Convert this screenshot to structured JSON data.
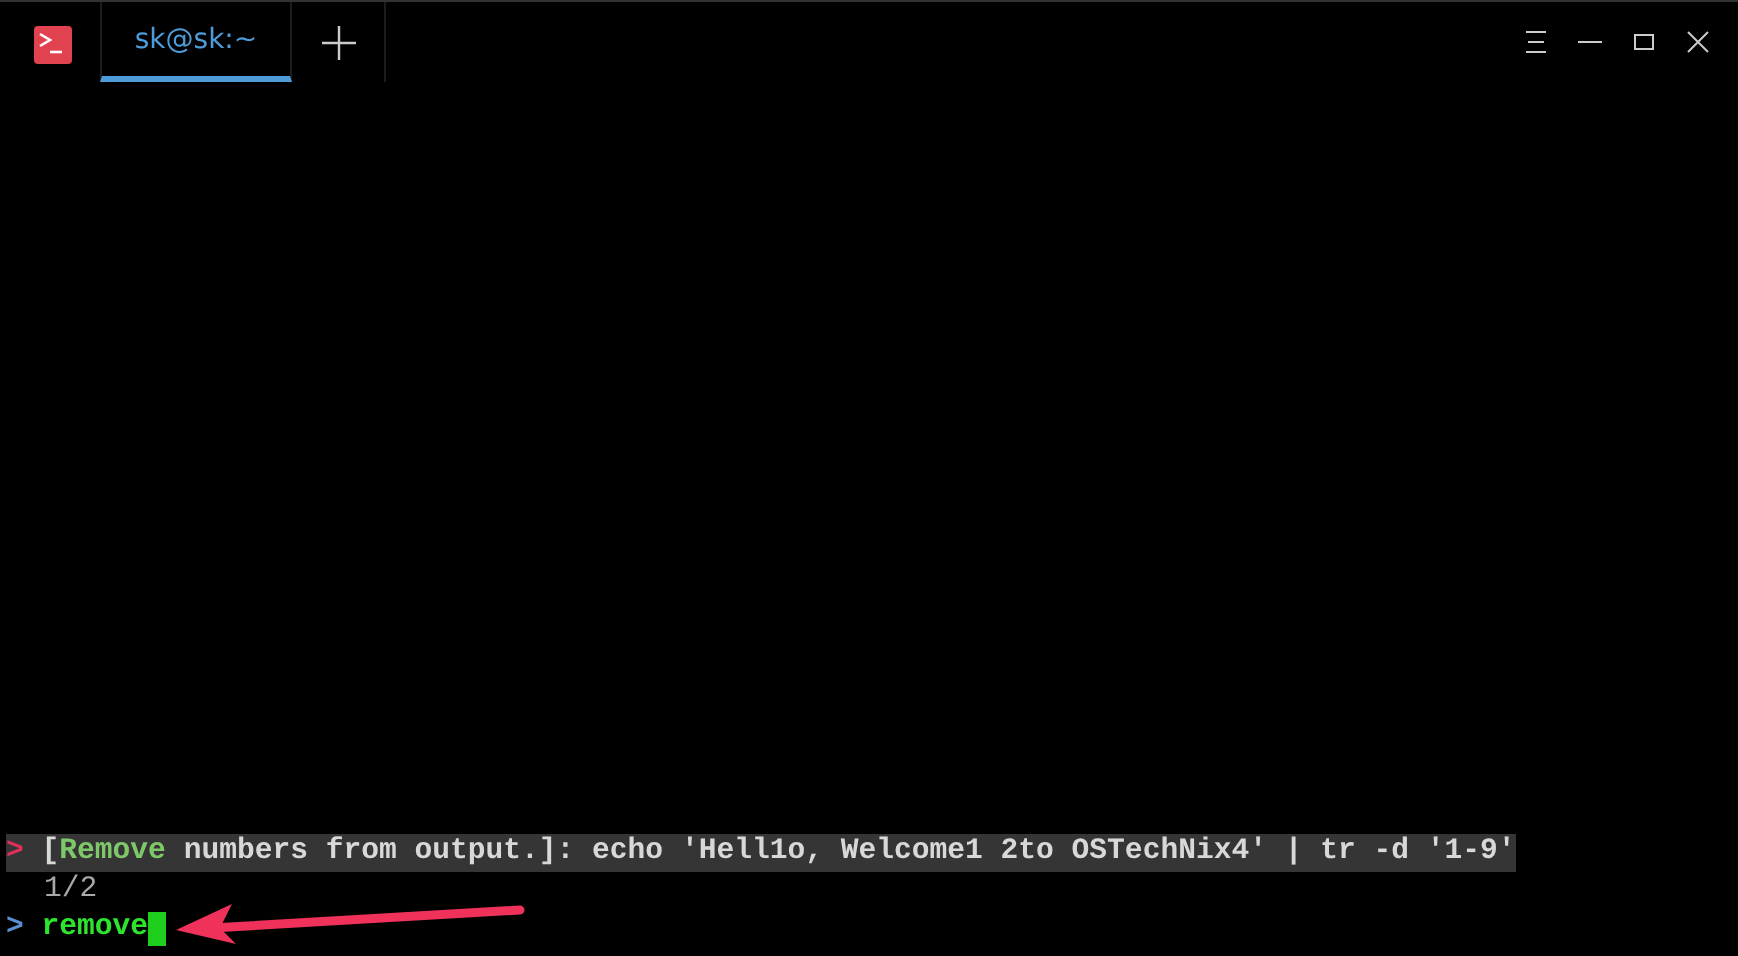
{
  "tabs": [
    {
      "label": "sk@sk:~",
      "selected": true
    }
  ],
  "terminal": {
    "lines": [
      {
        "kind": "candidate",
        "prompt": ">",
        "selected": true,
        "segments": [
          {
            "text": "[",
            "match": false
          },
          {
            "text": "Remove",
            "match": true
          },
          {
            "text": " numbers from output.]: echo 'Hell1o, Welcome1 2to OSTechNix4' | tr -d '1-9'",
            "match": false
          }
        ]
      },
      {
        "kind": "counter",
        "text": "1/2"
      },
      {
        "kind": "input",
        "prompt": ">",
        "text": "remove",
        "cursor": true
      }
    ]
  }
}
